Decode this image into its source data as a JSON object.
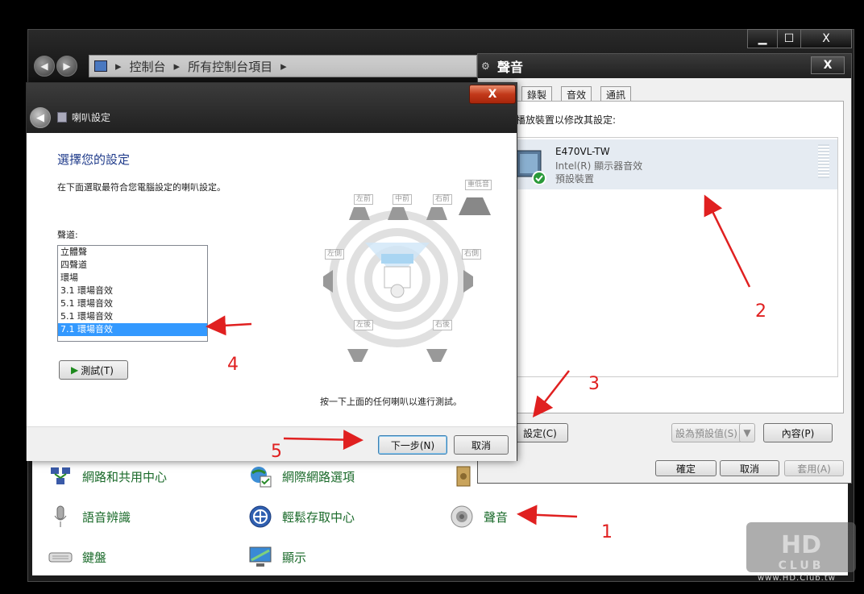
{
  "control_panel": {
    "breadcrumb": [
      "控制台",
      "所有控制台項目"
    ],
    "caption_buttons": {
      "minimize": "▁",
      "maximize": "☐",
      "close": "X"
    },
    "items": [
      {
        "label": "網路和共用中心",
        "icon": "network-icon"
      },
      {
        "label": "網際網路選項",
        "icon": "internet-options-icon"
      },
      {
        "label": "語音辨識",
        "icon": "microphone-icon"
      },
      {
        "label": "輕鬆存取中心",
        "icon": "ease-of-access-icon"
      },
      {
        "label": "聲音",
        "icon": "speaker-icon"
      },
      {
        "label": "鍵盤",
        "icon": "keyboard-icon"
      },
      {
        "label": "顯示",
        "icon": "display-icon"
      }
    ]
  },
  "sound_dialog": {
    "title": "聲音",
    "tabs": [
      "錄製",
      "音效",
      "通訊"
    ],
    "description": "下面的播放裝置以修改其設定:",
    "device": {
      "name": "E470VL-TW",
      "driver": "Intel(R) 顯示器音效",
      "status": "預設裝置"
    },
    "configure_button": "設定(C)",
    "set_default_button": "設為預設值(S)",
    "properties_button": "內容(P)",
    "ok_button": "確定",
    "cancel_button": "取消",
    "apply_button": "套用(A)"
  },
  "speaker_wizard": {
    "title": "喇叭設定",
    "heading": "選擇您的設定",
    "instruction": "在下面選取最符合您電腦設定的喇叭設定。",
    "channels_label": "聲道:",
    "channels": [
      "立體聲",
      "四聲道",
      "環場",
      "3.1 環場音效",
      "5.1 環場音效",
      "5.1 環場音效",
      "7.1 環場音效"
    ],
    "selected_channel": "7.1 環場音效",
    "test_button": "測試(T)",
    "speakers": {
      "front_left": "左前",
      "center": "中前",
      "front_right": "右前",
      "subwoofer": "重低音",
      "side_left": "左側",
      "side_right": "右側",
      "rear_left": "左後",
      "rear_right": "右後"
    },
    "hint": "按一下上面的任何喇叭以進行測試。",
    "next_button": "下一步(N)",
    "cancel_button": "取消"
  },
  "annotations": [
    "1",
    "2",
    "3",
    "4",
    "5"
  ],
  "watermark": {
    "text": "HD CLUB",
    "url": "www.HD.Club.tw"
  },
  "colors": {
    "accent_selection": "#3399ff",
    "annotation_red": "#e02020",
    "link_green": "#1a6a2a"
  }
}
